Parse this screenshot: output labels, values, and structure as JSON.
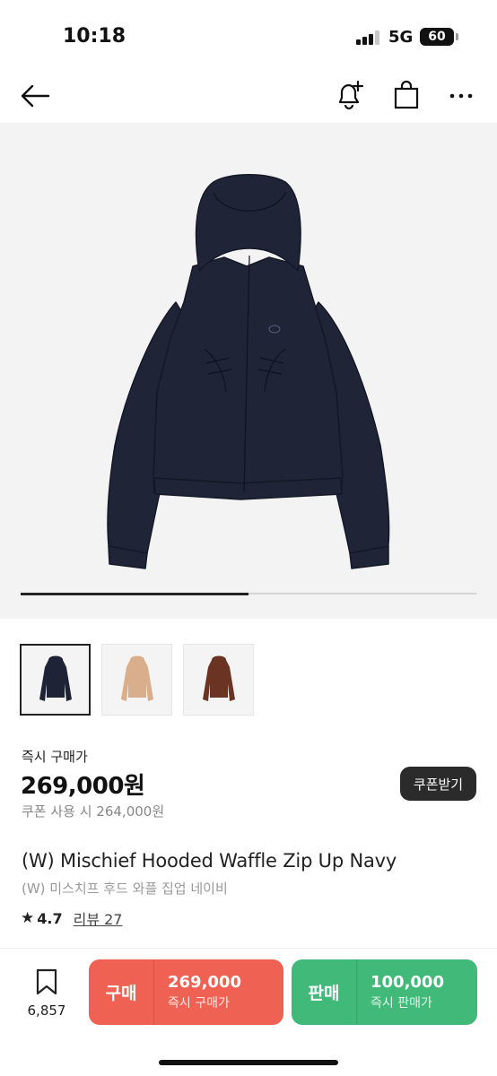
{
  "status_bar": {
    "time": "10:18",
    "network": "5G",
    "battery": "60"
  },
  "nav": {
    "back_icon": "arrow-left-icon",
    "alert_icon": "bell-plus-icon",
    "cart_icon": "shopping-bag-icon",
    "more_icon": "more-horizontal-icon"
  },
  "gallery": {
    "progress": 0.5
  },
  "thumbnails": [
    {
      "color": "navy",
      "hex": "#1e2436",
      "selected": true
    },
    {
      "color": "beige",
      "hex": "#d9ae8c",
      "selected": false
    },
    {
      "color": "brown",
      "hex": "#6a3322",
      "selected": false
    }
  ],
  "pricing": {
    "instant_buy_label": "즉시 구매가",
    "price": "269,000원",
    "coupon_price": "쿠폰 사용 시 264,000원",
    "coupon_button": "쿠폰받기"
  },
  "product": {
    "title_en": "(W) Mischief Hooded Waffle Zip Up Navy",
    "title_ko": "(W) 미스치프 후드 와플 집업 네이비",
    "rating": "4.7",
    "review_label": "리뷰 27"
  },
  "bottom_bar": {
    "wish_count": "6,857",
    "buy": {
      "label": "구매",
      "price": "269,000",
      "sub": "즉시 구매가"
    },
    "sell": {
      "label": "판매",
      "price": "100,000",
      "sub": "즉시 판매가"
    }
  },
  "colors": {
    "buy": "#ef6253",
    "sell": "#41b979",
    "dark": "#2b2b2b"
  }
}
